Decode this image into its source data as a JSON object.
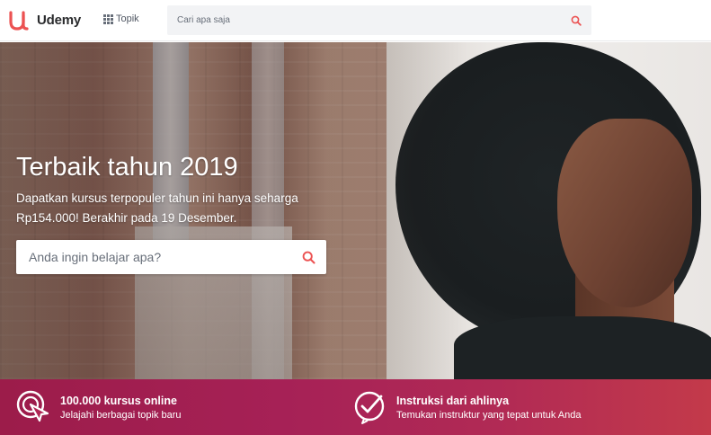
{
  "header": {
    "brand": "Udemy",
    "topics_label": "Topik",
    "search_placeholder": "Cari apa saja"
  },
  "hero": {
    "title": "Terbaik tahun 2019",
    "subtitle": "Dapatkan kursus terpopuler tahun ini hanya seharga Rp154.000! Berakhir pada 19 Desember.",
    "search_placeholder": "Anda ingin belajar apa?"
  },
  "features": [
    {
      "icon": "cursor-click-icon",
      "title": "100.000 kursus online",
      "desc": "Jelajahi berbagai topik baru"
    },
    {
      "icon": "checkmark-badge-icon",
      "title": "Instruksi dari ahlinya",
      "desc": "Temukan instruktur yang tepat untuk Anda"
    }
  ],
  "colors": {
    "brand": "#ec5252",
    "banner_start": "#9c1c4a",
    "banner_end": "#c33a4a"
  }
}
